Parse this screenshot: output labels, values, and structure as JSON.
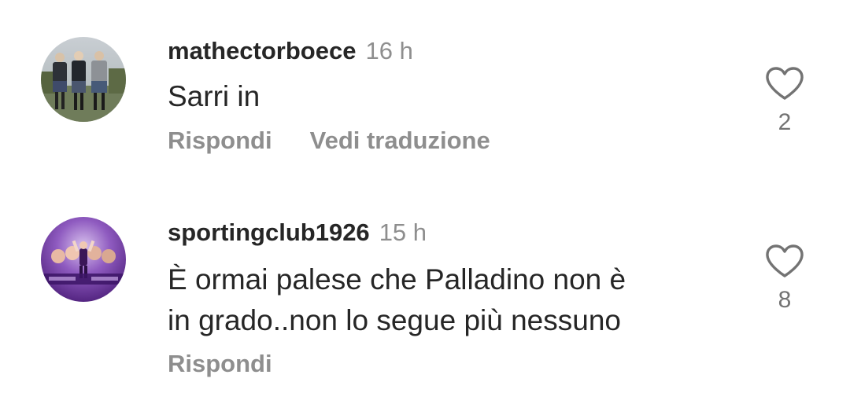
{
  "comments": [
    {
      "username": "mathectorboece",
      "time": "16 h",
      "text_lines": [
        "Sarri in"
      ],
      "actions": [
        "Rispondi",
        "Vedi traduzione"
      ],
      "likes": "2",
      "avatar_icon": "avatar-photo-men-in-kilts"
    },
    {
      "username": "sportingclub1926",
      "time": "15 h",
      "text_lines": [
        "È ormai palese che Palladino non è",
        "in grado..non lo segue più nessuno"
      ],
      "actions": [
        "Rispondi"
      ],
      "likes": "8",
      "avatar_icon": "avatar-photo-purple-team"
    }
  ],
  "colors": {
    "text": "#262626",
    "secondary": "#8e8e8e",
    "heart_outline": "#737373"
  }
}
